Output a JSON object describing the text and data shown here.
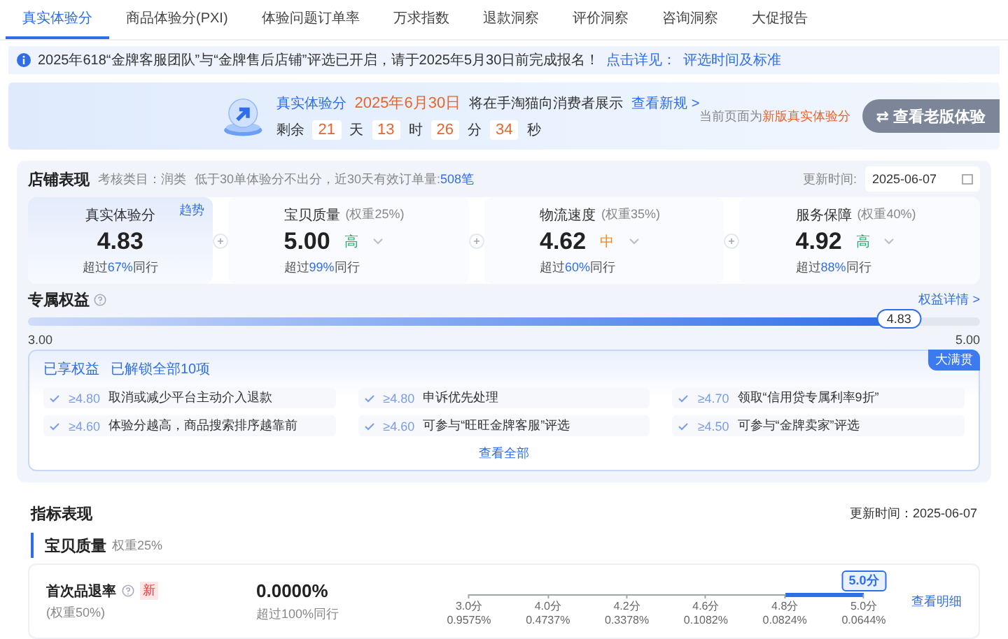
{
  "tabs": [
    {
      "label": "真实体验分",
      "selected": true
    },
    {
      "label": "商品体验分(PXI)",
      "selected": false
    },
    {
      "label": "体验问题订单率",
      "selected": false
    },
    {
      "label": "万求指数",
      "selected": false
    },
    {
      "label": "退款洞察",
      "selected": false
    },
    {
      "label": "评价洞察",
      "selected": false
    },
    {
      "label": "咨询洞察",
      "selected": false
    },
    {
      "label": "大促报告",
      "selected": false
    }
  ],
  "notice": {
    "text": "2025年618“金牌客服团队”与“金牌售后店铺”评选已开启，请于2025年5月30日前完成报名！",
    "link_prefix": "点击详见：",
    "link": "评选时间及标准"
  },
  "banner": {
    "title": "真实体验分",
    "date": "2025年6月30日",
    "text": "将在手淘猫向消费者展示",
    "link": "查看新规 >",
    "remaining_label": "剩余",
    "countdown": [
      {
        "value": "21",
        "unit": "天"
      },
      {
        "value": "13",
        "unit": "时"
      },
      {
        "value": "26",
        "unit": "分"
      },
      {
        "value": "34",
        "unit": "秒"
      }
    ],
    "current_prefix": "当前页面为",
    "current_version": "新版真实体验分",
    "switch_button": "⇄ 查看老版体验"
  },
  "store": {
    "title": "店铺表现",
    "category": "考核类目：润类",
    "rule": "低于30单体验分不出分，近30天有效订单量:",
    "orders": "508笔",
    "update_label": "更新时间:",
    "update_date": "2025-06-07",
    "metrics": [
      {
        "name": "真实体验分",
        "value": "4.83",
        "beat_prefix": "超过",
        "beat": "67%",
        "beat_suffix": "同行",
        "trend_link": "趋势",
        "selected": true
      },
      {
        "name": "宝贝质量",
        "weight": "(权重25%)",
        "value": "5.00",
        "tag": "高",
        "color": "#1fae6b",
        "beat_prefix": "超过",
        "beat": "99%",
        "beat_suffix": "同行",
        "selected": false
      },
      {
        "name": "物流速度",
        "weight": "(权重35%)",
        "value": "4.62",
        "tag": "中",
        "color": "#f08a1c",
        "beat_prefix": "超过",
        "beat": "60%",
        "beat_suffix": "同行",
        "selected": false
      },
      {
        "name": "服务保障",
        "weight": "(权重40%)",
        "value": "4.92",
        "tag": "高",
        "color": "#1fae6b",
        "beat_prefix": "超过",
        "beat": "88%",
        "beat_suffix": "同行",
        "selected": false
      }
    ]
  },
  "rights": {
    "title": "专属权益",
    "detail_link": "权益详情 >",
    "slider": {
      "level": 0.915,
      "thumb": "4.83",
      "min": "3.00",
      "max": "5.00"
    },
    "box": {
      "title": "已享权益",
      "unlocked": "已解锁全部10项",
      "badge": "大满贯",
      "view_all": "查看全部",
      "items": [
        {
          "threshold": "≥4.80",
          "text": "取消或减少平台主动介入退款"
        },
        {
          "threshold": "≥4.80",
          "text": "申诉优先处理"
        },
        {
          "threshold": "≥4.70",
          "text": "领取“信用贷专属利率9折”"
        },
        {
          "threshold": "≥4.60",
          "text": "体验分越高，商品搜索排序越靠前"
        },
        {
          "threshold": "≥4.60",
          "text": "可参与“旺旺金牌客服”评选"
        },
        {
          "threshold": "≥4.50",
          "text": "可参与“金牌卖家”评选"
        }
      ]
    }
  },
  "indicators": {
    "title": "指标表现",
    "update": "更新时间：2025-06-07",
    "section": "宝贝质量",
    "section_weight": "权重25%",
    "rows": [
      {
        "name": "首次品退率",
        "badge": "新",
        "weight": "(权重50%)",
        "value": "0.0000%",
        "beat": "超过100%同行",
        "marker": "5.0分",
        "level": 1,
        "link": "查看明细",
        "ticks": [
          {
            "label": "3.0分",
            "pct": "0.9575%"
          },
          {
            "label": "4.0分",
            "pct": "0.4737%"
          },
          {
            "label": "4.2分",
            "pct": "0.3378%"
          },
          {
            "label": "4.6分",
            "pct": "0.1082%"
          },
          {
            "label": "4.8分",
            "pct": "0.0824%"
          },
          {
            "label": "5.0分",
            "pct": "0.0644%"
          }
        ]
      }
    ]
  }
}
